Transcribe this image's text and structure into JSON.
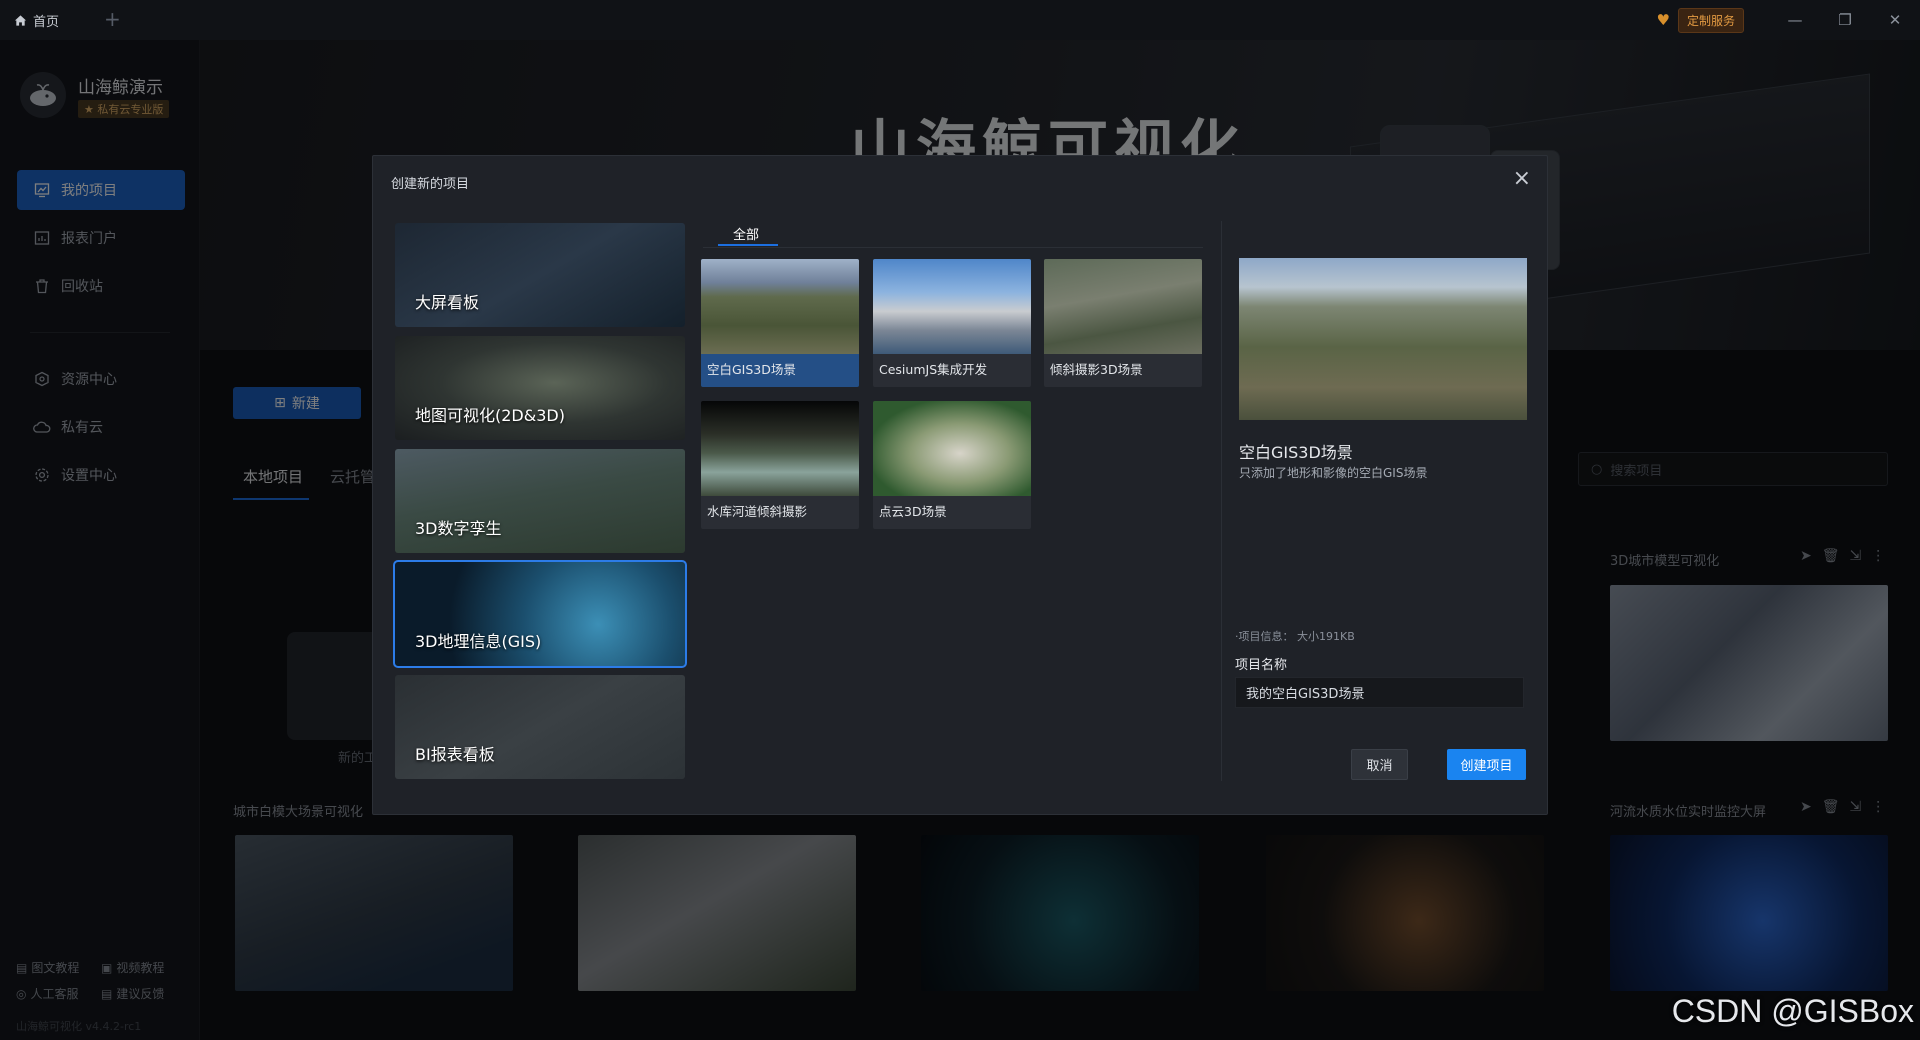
{
  "titlebar": {
    "home_tab": "首页",
    "service": "定制服务"
  },
  "sidebar": {
    "app_name": "山海鲸演示",
    "edition": "私有云专业版",
    "items": [
      {
        "label": "我的项目",
        "icon": "project-icon",
        "active": true
      },
      {
        "label": "报表门户",
        "icon": "report-icon"
      },
      {
        "label": "回收站",
        "icon": "trash-icon"
      },
      {
        "label": "资源中心",
        "icon": "resource-icon"
      },
      {
        "label": "私有云",
        "icon": "cloud-icon"
      },
      {
        "label": "设置中心",
        "icon": "settings-icon"
      }
    ],
    "footer": [
      "图文教程",
      "视频教程",
      "人工客服",
      "建议反馈"
    ],
    "version": "山海鲸可视化 v4.4.2-rc1"
  },
  "main": {
    "hero_title": "山海鲸可视化",
    "new_button": "新建",
    "tabs": [
      "本地项目",
      "云托管"
    ],
    "search_placeholder": "搜索项目",
    "new_label": "新的工",
    "cards": [
      {
        "title": "3D城市模型可视化"
      },
      {
        "title": "城市白模大场景可视化"
      },
      {
        "title": "河流水质水位实时监控大屏"
      }
    ]
  },
  "modal": {
    "title": "创建新的项目",
    "categories": [
      {
        "label": "大屏看板"
      },
      {
        "label": "地图可视化(2D&3D)"
      },
      {
        "label": "3D数字孪生"
      },
      {
        "label": "3D地理信息(GIS)",
        "selected": true
      },
      {
        "label": "BI报表看板"
      }
    ],
    "filter_tab": "全部",
    "templates": [
      {
        "label": "空白GIS3D场景",
        "selected": true
      },
      {
        "label": "CesiumJS集成开发"
      },
      {
        "label": "倾斜摄影3D场景"
      },
      {
        "label": "水库河道倾斜摄影"
      },
      {
        "label": "点云3D场景"
      }
    ],
    "preview": {
      "title": "空白GIS3D场景",
      "desc": "只添加了地形和影像的空白GIS场景",
      "info": "·项目信息：  大小191KB",
      "name_label": "项目名称",
      "name_value": "我的空白GIS3D场景"
    },
    "cancel": "取消",
    "create": "创建项目"
  },
  "watermark": "CSDN @GISBox",
  "colors": {
    "accent": "#1a84f0",
    "sidebar_active": "#1c64c8"
  }
}
